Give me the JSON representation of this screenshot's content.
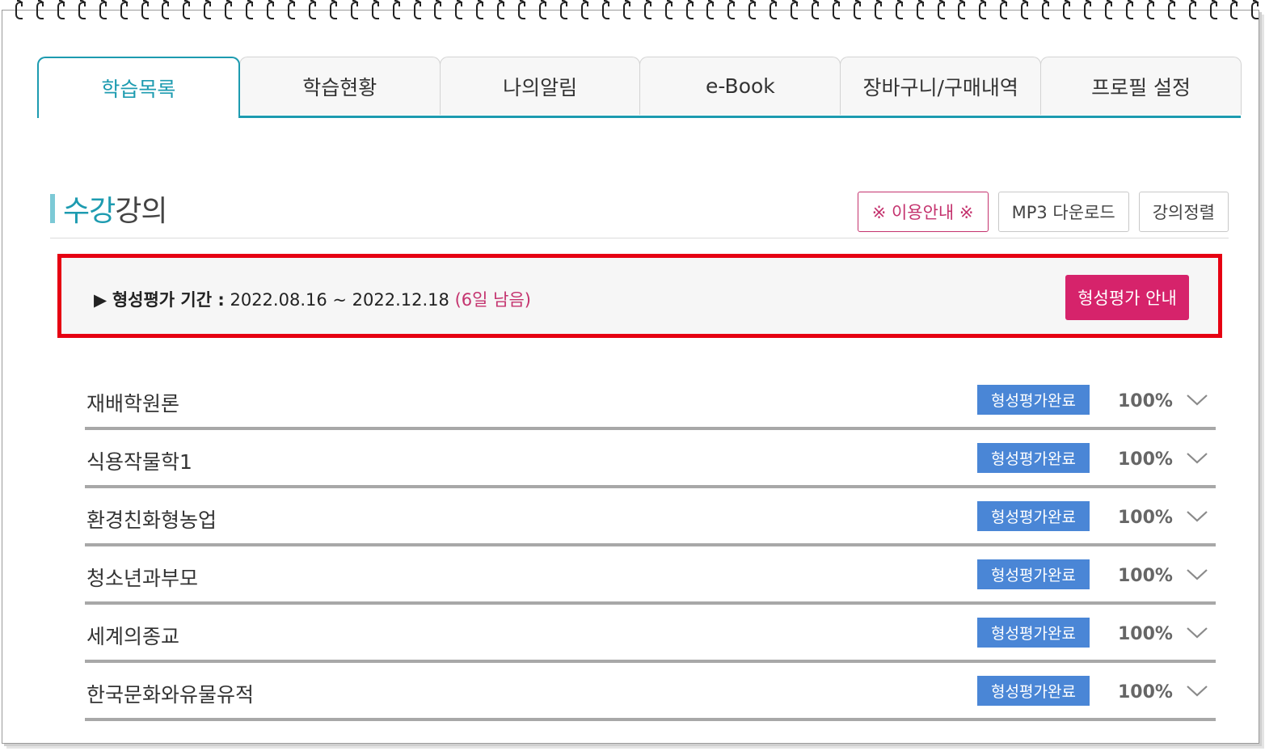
{
  "tabs": [
    {
      "label": "학습목록",
      "active": true
    },
    {
      "label": "학습현황",
      "active": false
    },
    {
      "label": "나의알림",
      "active": false
    },
    {
      "label": "e-Book",
      "active": false
    },
    {
      "label": "장바구니/구매내역",
      "active": false
    },
    {
      "label": "프로필 설정",
      "active": false
    }
  ],
  "section": {
    "title_highlight": "수강",
    "title_rest": "강의",
    "buttons": {
      "usage_guide": "※ 이용안내 ※",
      "mp3_download": "MP3 다운로드",
      "sort": "강의정렬"
    }
  },
  "period": {
    "marker": "▶",
    "label": "형성평가 기간 :",
    "range": " 2022.08.16 ~ 2022.12.18 ",
    "remaining": "(6일 남음)",
    "guide_button": "형성평가 안내"
  },
  "courses": [
    {
      "name": "재배학원론",
      "status": "형성평가완료",
      "progress": "100%"
    },
    {
      "name": "식용작물학1",
      "status": "형성평가완료",
      "progress": "100%"
    },
    {
      "name": "환경친화형농업",
      "status": "형성평가완료",
      "progress": "100%"
    },
    {
      "name": "청소년과부모",
      "status": "형성평가완료",
      "progress": "100%"
    },
    {
      "name": "세계의종교",
      "status": "형성평가완료",
      "progress": "100%"
    },
    {
      "name": "한국문화와유물유적",
      "status": "형성평가완료",
      "progress": "100%"
    }
  ],
  "colors": {
    "accent": "#1d9bb0",
    "pink": "#d6236b",
    "badge": "#4a86d6",
    "highlight_border": "#e60012"
  }
}
